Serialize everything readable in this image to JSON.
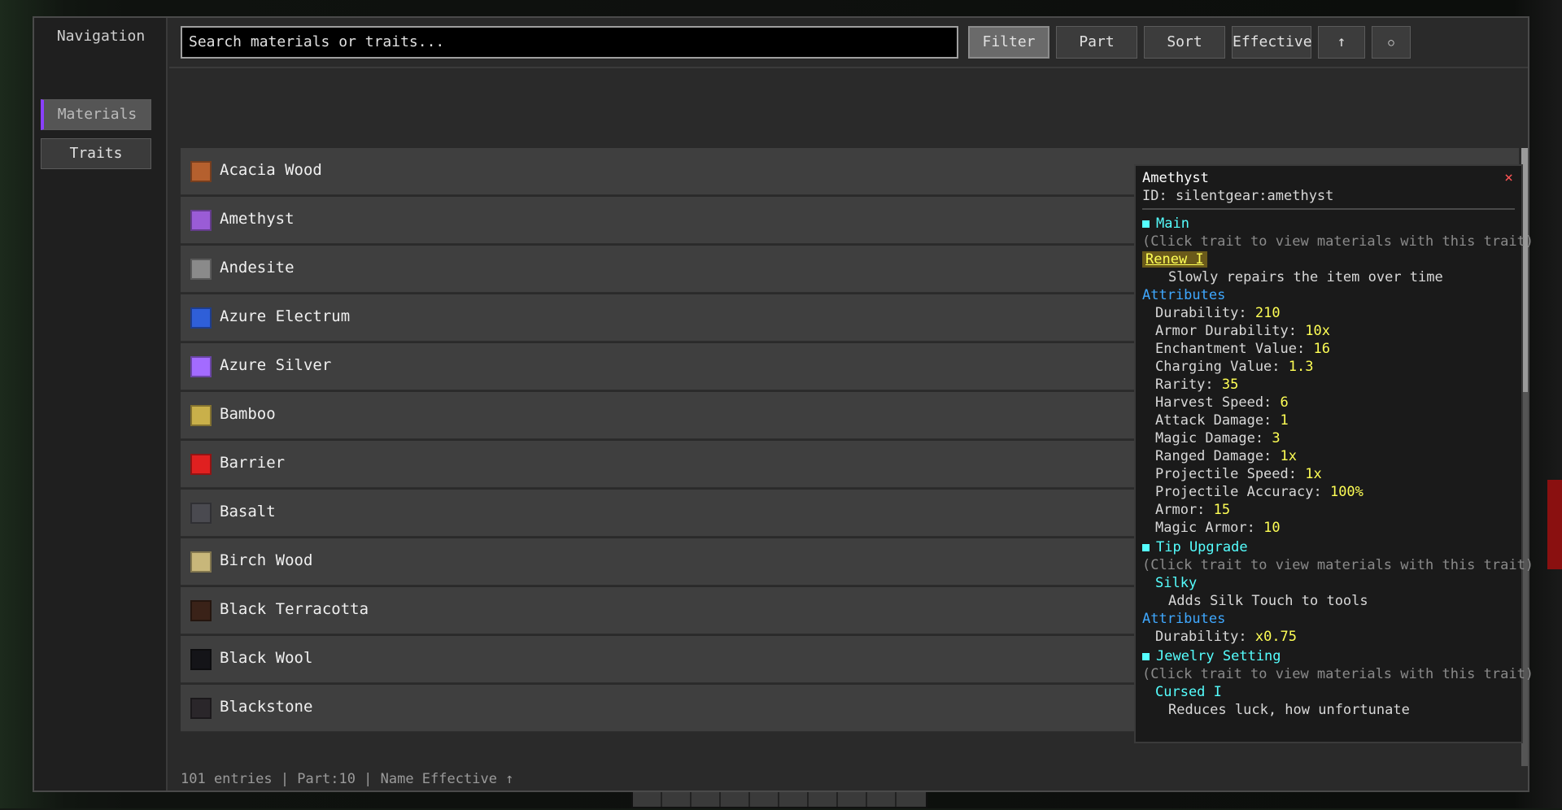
{
  "navigation": {
    "title": "Navigation",
    "items": [
      {
        "label": "Materials",
        "active": true
      },
      {
        "label": "Traits",
        "active": false
      }
    ]
  },
  "toolbar": {
    "search_placeholder": "Search materials or traits...",
    "filter_label": "Filter",
    "part_label": "Part",
    "sort_label": "Sort",
    "effective_label": "Effective",
    "arrow_label": "↑",
    "circle_label": "○"
  },
  "materials": [
    {
      "name": "Acacia Wood",
      "color": "#b5602e"
    },
    {
      "name": "Amethyst",
      "color": "#9a5cd6"
    },
    {
      "name": "Andesite",
      "color": "#8a8a8a"
    },
    {
      "name": "Azure Electrum",
      "color": "#2f5fd8"
    },
    {
      "name": "Azure Silver",
      "color": "#a36bff"
    },
    {
      "name": "Bamboo",
      "color": "#c9b04a"
    },
    {
      "name": "Barrier",
      "color": "#e02020"
    },
    {
      "name": "Basalt",
      "color": "#4a4a50"
    },
    {
      "name": "Birch Wood",
      "color": "#c8b77a"
    },
    {
      "name": "Black Terracotta",
      "color": "#3a2218"
    },
    {
      "name": "Black Wool",
      "color": "#141418"
    },
    {
      "name": "Blackstone",
      "color": "#2a262a"
    }
  ],
  "status": "101 entries | Part:10 | Name Effective ↑",
  "tooltip": {
    "title": "Amethyst",
    "close": "×",
    "id": "ID: silentgear:amethyst",
    "sections": {
      "main": {
        "header": "Main",
        "hint": "(Click trait to view materials with this trait)",
        "trait": "Renew I",
        "trait_desc": "Slowly repairs the item over time",
        "attributes_header": "Attributes",
        "attributes": [
          {
            "label": "Durability:",
            "value": "210"
          },
          {
            "label": "Armor Durability:",
            "value": "10x"
          },
          {
            "label": "Enchantment Value:",
            "value": "16"
          },
          {
            "label": "Charging Value:",
            "value": "1.3"
          },
          {
            "label": "Rarity:",
            "value": "35"
          },
          {
            "label": "Harvest Speed:",
            "value": "6"
          },
          {
            "label": "Attack Damage:",
            "value": "1"
          },
          {
            "label": "Magic Damage:",
            "value": "3"
          },
          {
            "label": "Ranged Damage:",
            "value": "1x"
          },
          {
            "label": "Projectile Speed:",
            "value": "1x"
          },
          {
            "label": "Projectile Accuracy:",
            "value": "100%"
          },
          {
            "label": "Armor:",
            "value": "15"
          },
          {
            "label": "Magic Armor:",
            "value": "10"
          }
        ]
      },
      "tip": {
        "header": "Tip Upgrade",
        "hint": "(Click trait to view materials with this trait)",
        "trait": "Silky",
        "trait_desc": "Adds Silk Touch to tools",
        "attributes_header": "Attributes",
        "attributes": [
          {
            "label": "Durability:",
            "value": "x0.75"
          }
        ]
      },
      "jewelry": {
        "header": "Jewelry Setting",
        "hint": "(Click trait to view materials with this trait)",
        "trait": "Cursed I",
        "trait_desc": "Reduces luck, how unfortunate"
      }
    }
  }
}
